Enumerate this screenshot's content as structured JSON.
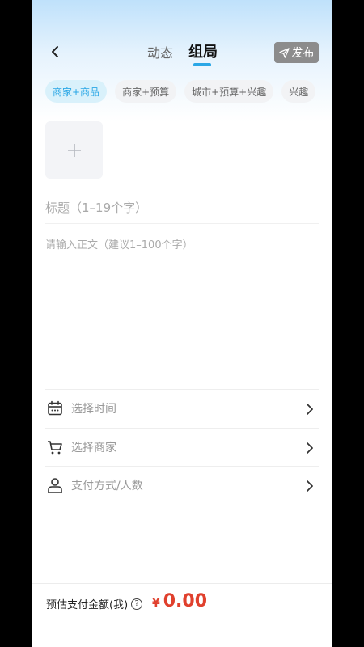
{
  "header": {
    "tabs": [
      {
        "label": "动态",
        "active": false
      },
      {
        "label": "组局",
        "active": true
      }
    ],
    "publish_label": "发布"
  },
  "chips": [
    {
      "label": "商家+商品",
      "active": true
    },
    {
      "label": "商家+预算",
      "active": false
    },
    {
      "label": "城市+预算+兴趣",
      "active": false
    },
    {
      "label": "兴趣",
      "active": false
    }
  ],
  "form": {
    "title_placeholder": "标题（1–19个字）",
    "body_placeholder": "请输入正文（建议1–100个字）"
  },
  "options": [
    {
      "label": "选择时间",
      "icon": "calendar-icon"
    },
    {
      "label": "选择商家",
      "icon": "cart-icon"
    },
    {
      "label": "支付方式/人数",
      "icon": "user-icon"
    }
  ],
  "footer": {
    "label": "预估支付金额(我)",
    "currency": "¥",
    "amount": "0.00"
  },
  "colors": {
    "accent": "#2aa7e6",
    "price": "#e0402d",
    "publish_bg": "#8c8c8c"
  }
}
